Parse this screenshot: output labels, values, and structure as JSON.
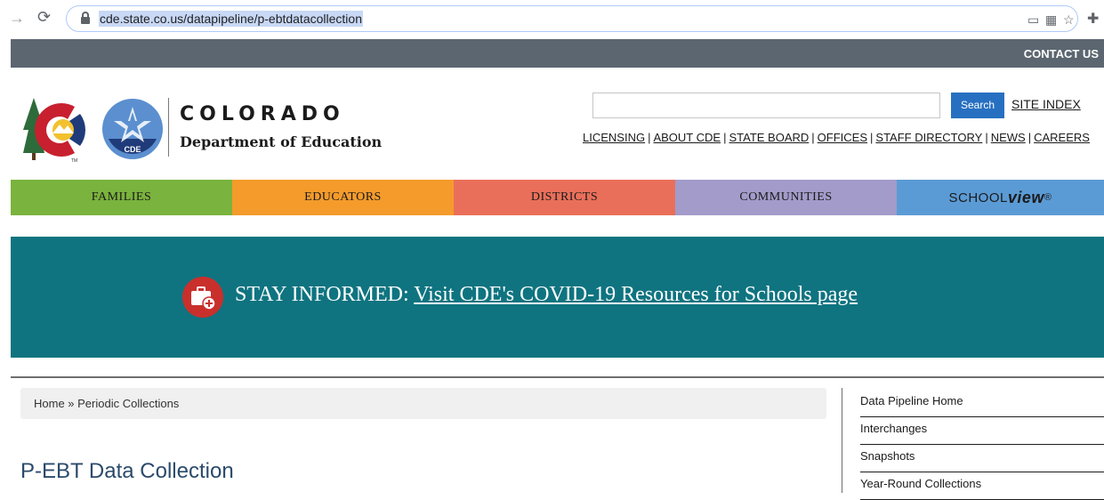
{
  "browser": {
    "url": "cde.state.co.us/datapipeline/p-ebtdatacollection",
    "icons": [
      "forward-icon",
      "reload-icon",
      "lock-icon",
      "cast-icon",
      "qr-icon",
      "bookmark-star-icon",
      "extensions-icon"
    ]
  },
  "topbar": {
    "contact": "CONTACT US"
  },
  "header": {
    "org_name": "COLORADO",
    "org_dept": "Department of Education",
    "cde_badge": "CDE",
    "search_button": "Search",
    "site_index": "SITE INDEX",
    "util_links": [
      "LICENSING",
      "ABOUT CDE",
      "STATE BOARD",
      "OFFICES",
      "STAFF DIRECTORY",
      "NEWS",
      "CAREERS"
    ]
  },
  "mainnav": {
    "items": [
      "FAMILIES",
      "EDUCATORS",
      "DISTRICTS",
      "COMMUNITIES"
    ],
    "schoolview_a": "SCHOOL",
    "schoolview_b": "view",
    "schoolview_mark": "®"
  },
  "banner": {
    "prefix": "STAY INFORMED: ",
    "link": "Visit CDE's COVID-19 Resources for Schools page"
  },
  "breadcrumb": "Home » Periodic Collections",
  "page_title": "P-EBT Data Collection",
  "sidebar": {
    "items": [
      "Data Pipeline Home",
      "Interchanges",
      "Snapshots",
      "Year-Round Collections"
    ]
  },
  "colors": {
    "topbar": "#5b6670",
    "families": "#7ab33d",
    "educators": "#f49b2b",
    "districts": "#ea6f5a",
    "communities": "#a39bca",
    "schoolview": "#5b9bd5",
    "banner": "#0f7480",
    "search_button": "#2770c1"
  }
}
